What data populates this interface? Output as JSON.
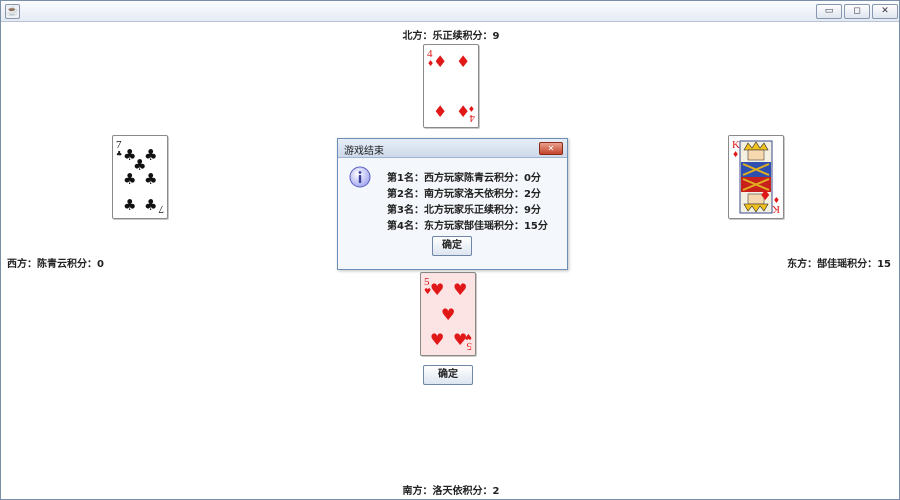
{
  "window": {
    "title": "",
    "app_icon": "java-coffee-icon",
    "controls": {
      "minimize": "▭",
      "maximize": "◻",
      "close": "✕"
    }
  },
  "players": {
    "north": "北方：乐正续积分：9",
    "south": "南方：洛天依积分：2",
    "west": "西方：陈青云积分：0",
    "east": "东方：郜佳瑶积分：15"
  },
  "cards": {
    "north": {
      "rank": "4",
      "suit": "diamonds",
      "suit_glyph": "♦",
      "color": "#e01818"
    },
    "west": {
      "rank": "7",
      "suit": "clubs",
      "suit_glyph": "♣",
      "color": "#111111"
    },
    "east": {
      "rank": "K",
      "suit": "diamonds",
      "suit_glyph": "♦",
      "color": "#e01818",
      "face_card": true
    },
    "south": {
      "rank": "5",
      "suit": "hearts",
      "suit_glyph": "♥",
      "color": "#e01818",
      "highlighted": true
    }
  },
  "main_button": {
    "label": "确定"
  },
  "dialog": {
    "title": "游戏结束",
    "icon": "info-icon",
    "close_glyph": "✕",
    "results": [
      "第1名：西方玩家陈青云积分：0分",
      "第2名：南方玩家洛天依积分：2分",
      "第3名：北方玩家乐正续积分：9分",
      "第4名：东方玩家郜佳瑶积分：15分"
    ],
    "ok_label": "确定"
  },
  "colors": {
    "red_suit": "#e01818",
    "black_suit": "#111111",
    "highlight_card": "#fde4e4",
    "dialog_border": "#6c8fb8"
  }
}
